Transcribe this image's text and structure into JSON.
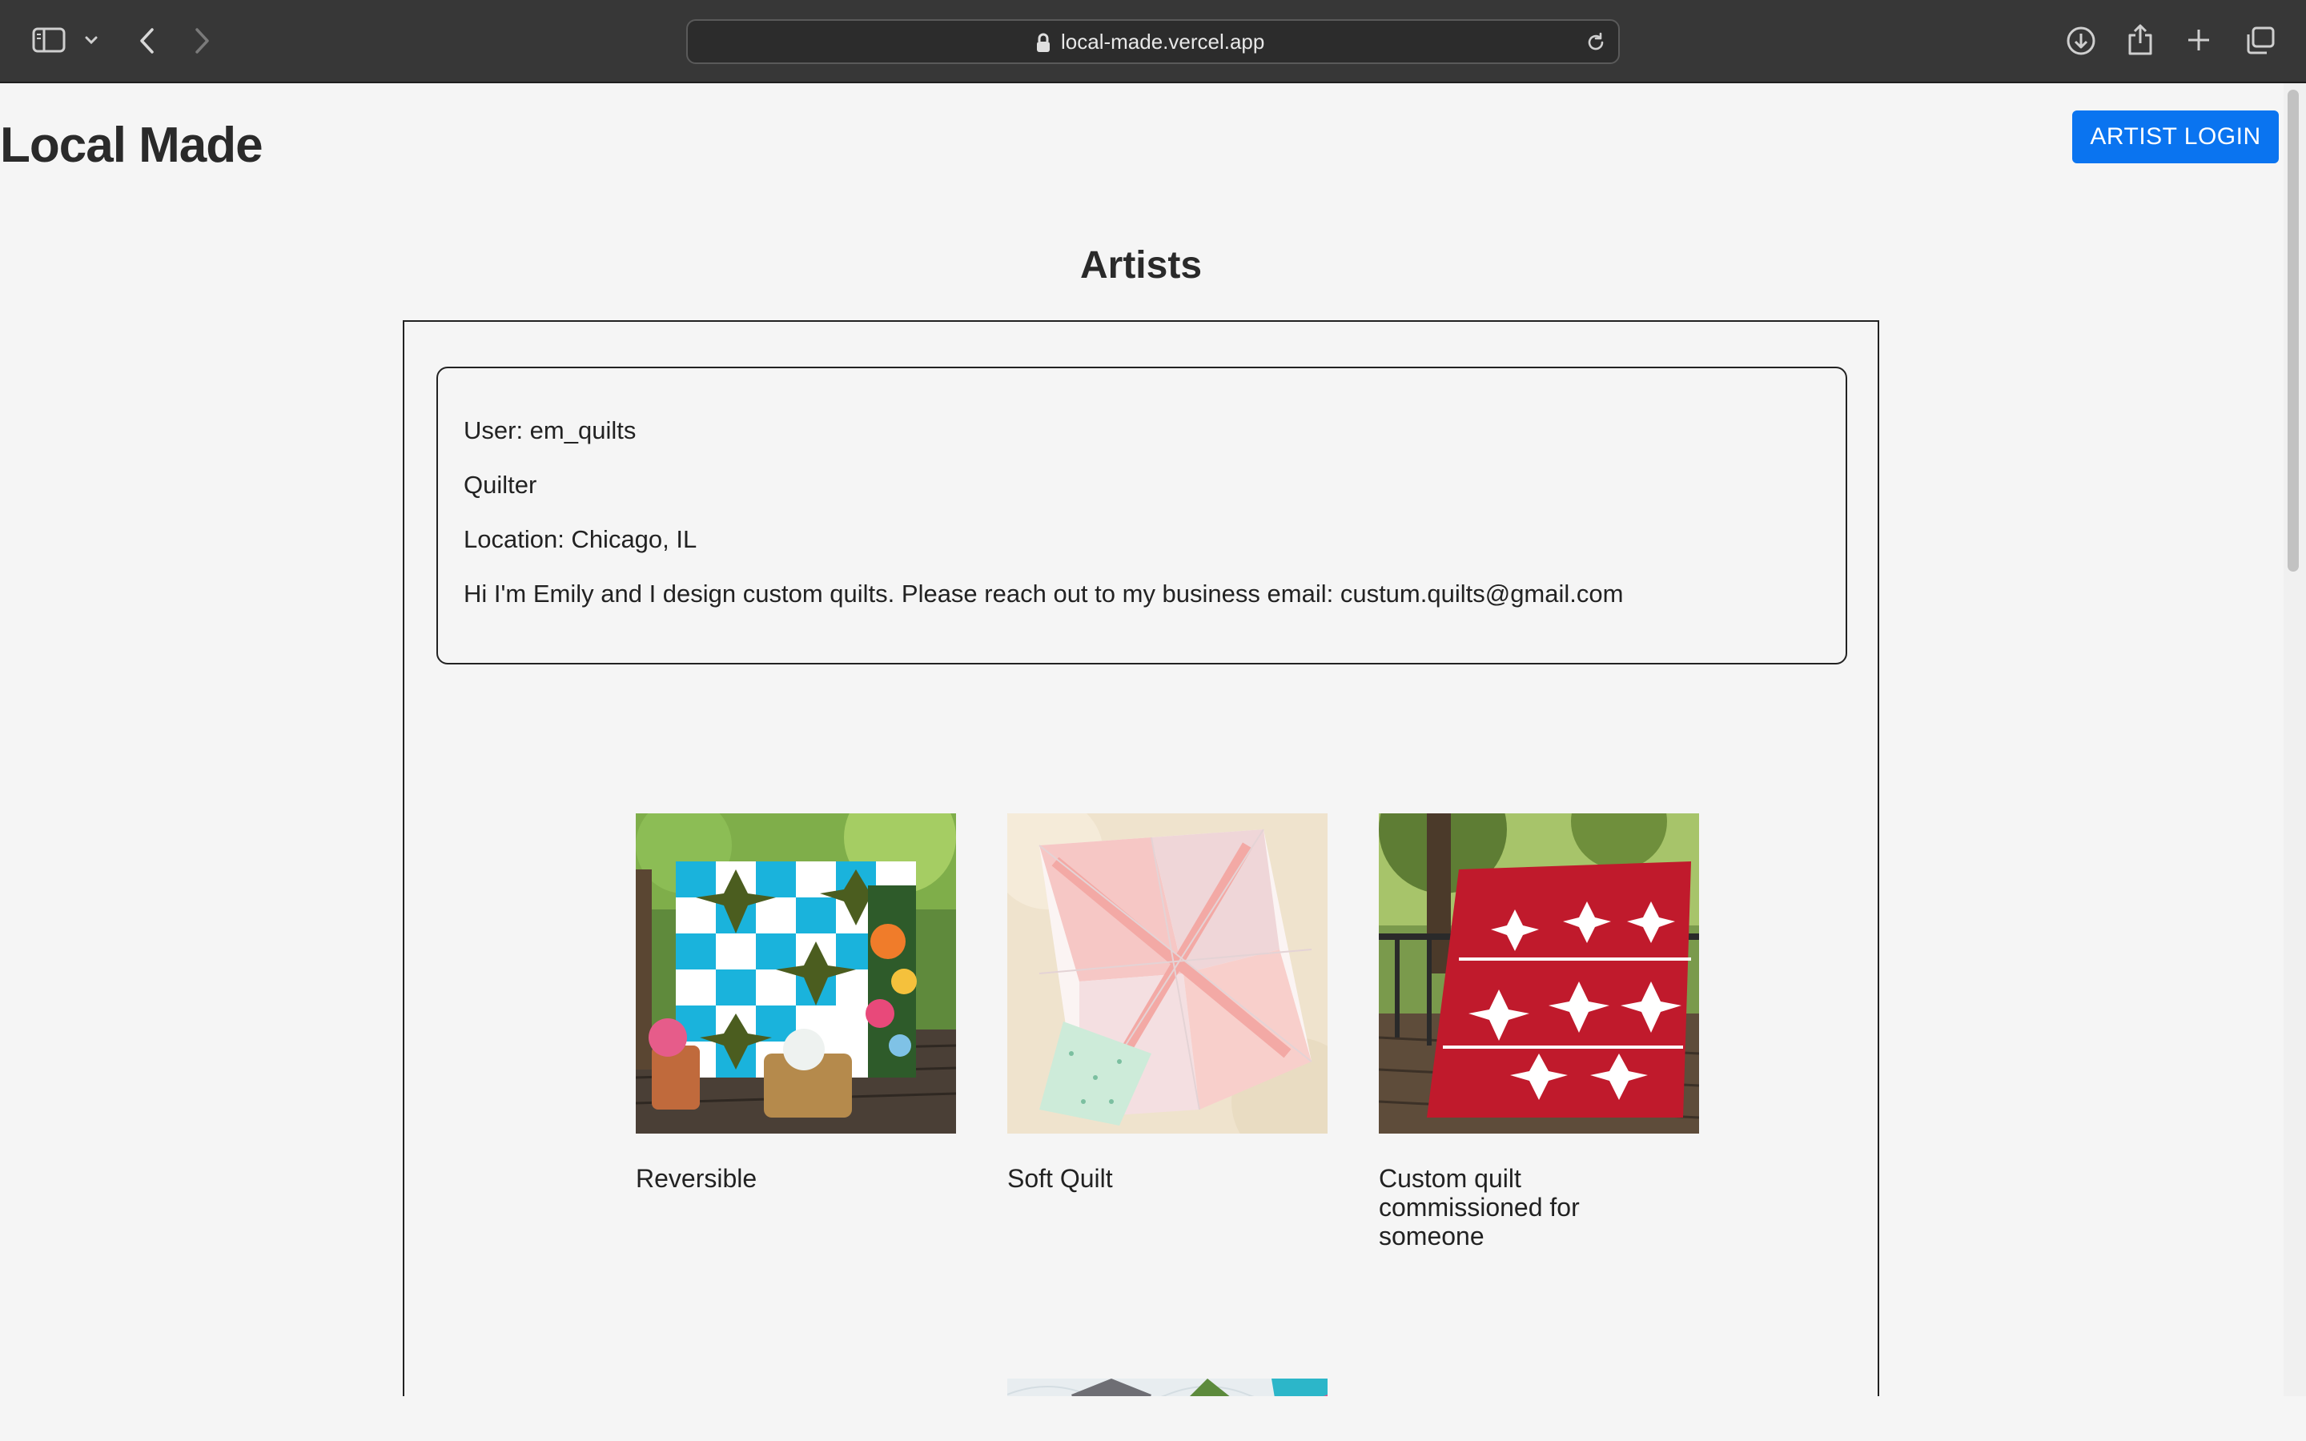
{
  "browser": {
    "url": "local-made.vercel.app",
    "icons": [
      "sidebar-icon",
      "chevron-down-icon",
      "back-arrow-icon",
      "forward-arrow-icon",
      "lock-icon",
      "reload-icon",
      "download-icon",
      "share-icon",
      "new-tab-icon",
      "tabs-overview-icon"
    ]
  },
  "header": {
    "site_title": "Local Made",
    "login_label": "ARTIST LOGIN"
  },
  "main": {
    "section_title": "Artists",
    "artist": {
      "user": "User: em_quilts",
      "craft": "Quilter",
      "location": "Location: Chicago, IL",
      "bio": "Hi I'm Emily and I design custom quilts. Please reach out to my business email: custum.quilts@gmail.com"
    },
    "works": [
      {
        "caption": "Reversible"
      },
      {
        "caption": "Soft Quilt"
      },
      {
        "caption": "Custom quilt commissioned for someone"
      },
      {
        "caption": ""
      }
    ]
  },
  "colors": {
    "accent": "#0a74f0",
    "page_bg": "#f5f5f5",
    "chrome_bg": "#373737"
  }
}
